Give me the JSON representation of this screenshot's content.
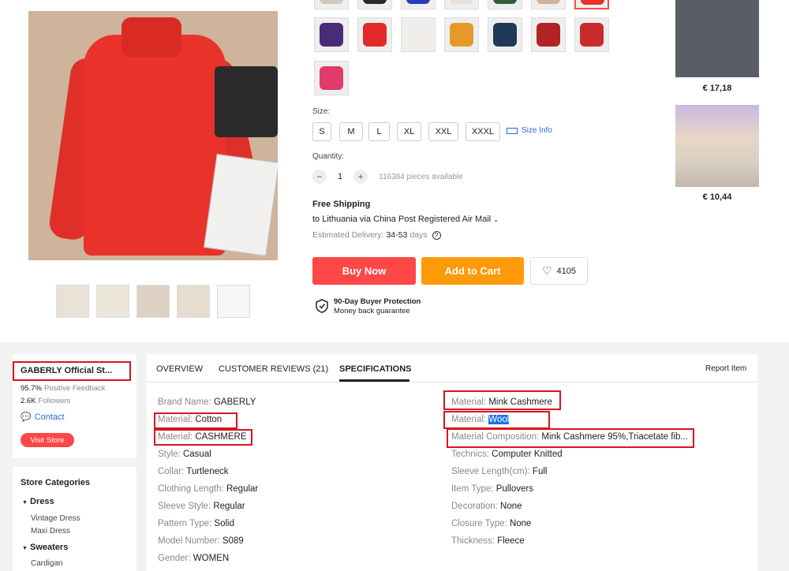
{
  "colors": {
    "buy_now": "#ff4747",
    "add_to_cart": "#ff9a0a",
    "highlight_box": "#d8141f",
    "selection": "#1a73e8",
    "link_blue": "#2b6ccf"
  },
  "swatches_row1": [
    "#cfc6bd",
    "#2a2a2a",
    "#2a3bbd",
    "#e7dfd6",
    "#2f5e36",
    "#cdb49a",
    "#e8322a"
  ],
  "swatches_row2": [
    "#4a2b78",
    "#e22a2a",
    "#f1eeea",
    "#e39a2a",
    "#1e3a56",
    "#b32326",
    "#c92a2a"
  ],
  "swatches_row3": [
    "#e23a6a"
  ],
  "size": {
    "label": "Size:",
    "options": [
      "S",
      "M",
      "L",
      "XL",
      "XXL",
      "XXXL"
    ],
    "info": "Size Info"
  },
  "quantity": {
    "label": "Quantity:",
    "minus": "−",
    "value": "1",
    "plus": "+",
    "available": "116384 pieces available"
  },
  "shipping": {
    "title": "Free Shipping",
    "to": "to Lithuania via China Post Registered Air Mail",
    "estimated_label": "Estimated Delivery:",
    "estimated_value": "34-53",
    "estimated_unit": "days"
  },
  "actions": {
    "buy_now": "Buy Now",
    "add_to_cart": "Add to Cart",
    "wishlist_count": "4105"
  },
  "protection": {
    "title": "90-Day Buyer Protection",
    "subtitle": "Money back guarantee"
  },
  "related": [
    {
      "price": "€ 17,18"
    },
    {
      "price": "€ 10,44"
    }
  ],
  "store": {
    "name": "GABERLY Official St...",
    "feedback_value": "95.7%",
    "feedback_label": "Positive Feedback",
    "followers_value": "2.6K",
    "followers_label": "Followers",
    "contact": "Contact",
    "visit": "Visit Store"
  },
  "categories": {
    "title": "Store Categories",
    "groups": [
      {
        "name": "Dress",
        "items": [
          "Vintage Dress",
          "Maxi Dress"
        ]
      },
      {
        "name": "Sweaters",
        "items": [
          "Cardigan"
        ]
      }
    ]
  },
  "tabs": {
    "overview": "OVERVIEW",
    "reviews": "CUSTOMER REVIEWS (21)",
    "specifications": "SPECIFICATIONS",
    "report": "Report Item"
  },
  "specs_left": [
    {
      "k": "Brand Name:",
      "v": "GABERLY"
    },
    {
      "k": "Material:",
      "v": "Cotton"
    },
    {
      "k": "Material:",
      "v": "CASHMERE"
    },
    {
      "k": "Style:",
      "v": "Casual"
    },
    {
      "k": "Collar:",
      "v": "Turtleneck"
    },
    {
      "k": "Clothing Length:",
      "v": "Regular"
    },
    {
      "k": "Sleeve Style:",
      "v": "Regular"
    },
    {
      "k": "Pattern Type:",
      "v": "Solid"
    },
    {
      "k": "Model Number:",
      "v": "S089"
    },
    {
      "k": "Gender:",
      "v": "WOMEN"
    }
  ],
  "specs_right": [
    {
      "k": "Material:",
      "v": "Mink Cashmere"
    },
    {
      "k": "Material:",
      "v": "Wool"
    },
    {
      "k": "Material Composition:",
      "v": "Mink Cashmere 95%,Triacetate fib..."
    },
    {
      "k": "Technics:",
      "v": "Computer Knitted"
    },
    {
      "k": "Sleeve Length(cm):",
      "v": "Full"
    },
    {
      "k": "Item Type:",
      "v": "Pullovers"
    },
    {
      "k": "Decoration:",
      "v": "None"
    },
    {
      "k": "Closure Type:",
      "v": "None"
    },
    {
      "k": "Thickness:",
      "v": "Fleece"
    }
  ]
}
